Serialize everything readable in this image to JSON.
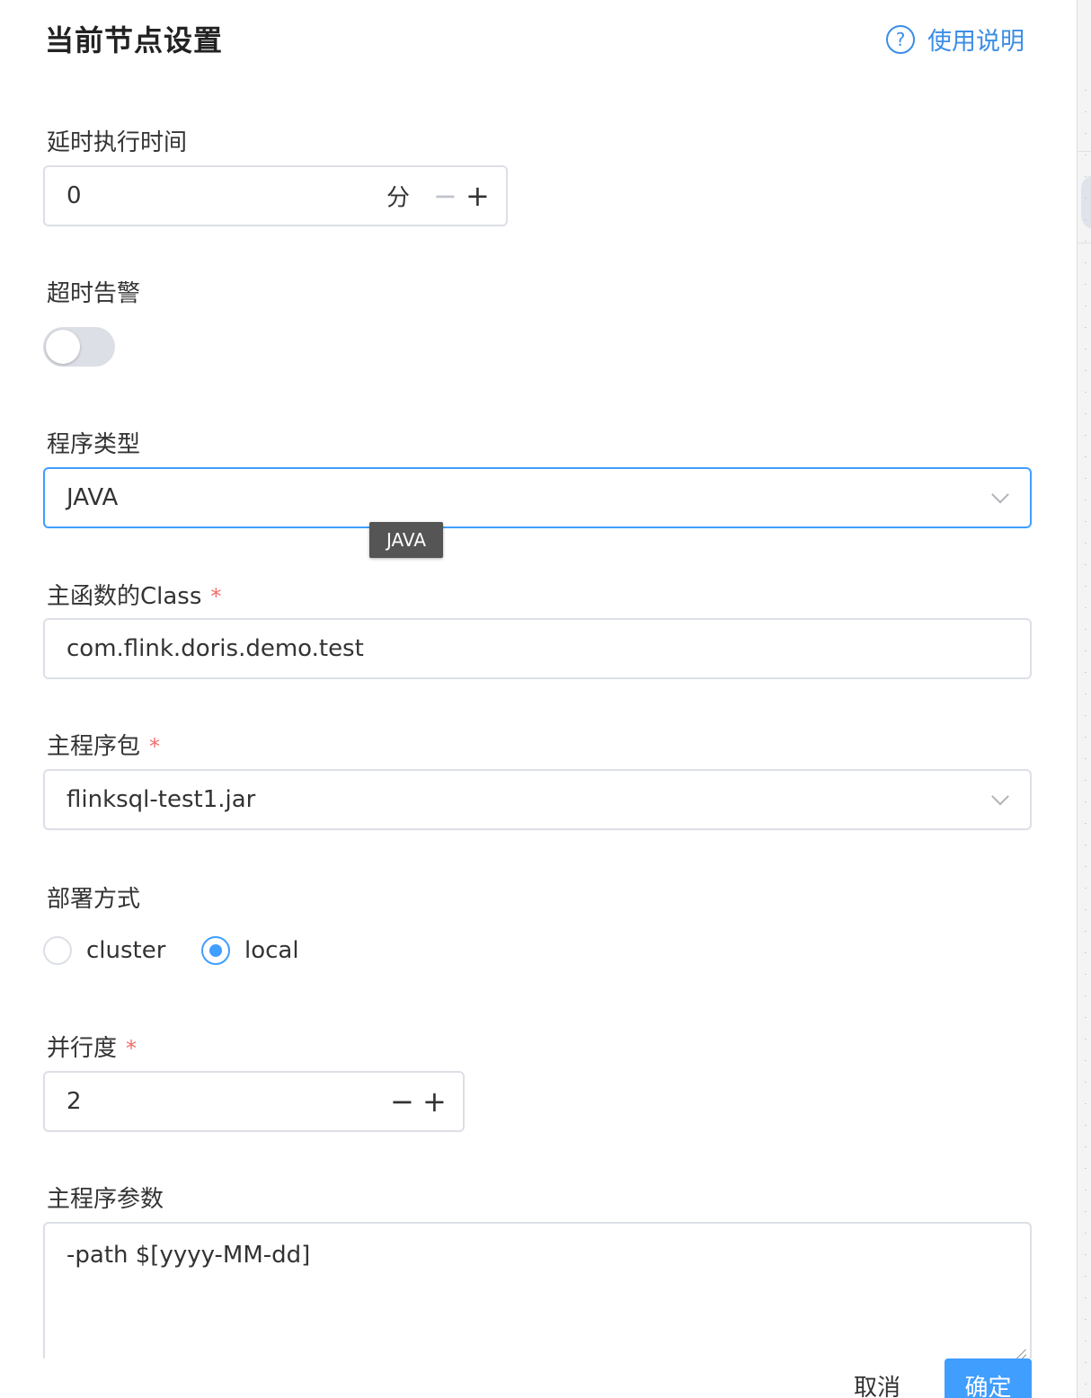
{
  "header": {
    "title": "当前节点设置",
    "help_label": "使用说明",
    "help_icon": "question-circle-icon"
  },
  "delay": {
    "label": "延时执行时间",
    "value": "0",
    "unit": "分",
    "minus": "−",
    "plus": "+"
  },
  "timeout_alarm": {
    "label": "超时告警",
    "enabled": false
  },
  "program_type": {
    "label": "程序类型",
    "value": "JAVA",
    "tooltip": "JAVA"
  },
  "main_class": {
    "label": "主函数的Class",
    "required": "*",
    "value": "com.flink.doris.demo.test"
  },
  "main_package": {
    "label": "主程序包",
    "required": "*",
    "value": "flinksql-test1.jar"
  },
  "deploy_mode": {
    "label": "部署方式",
    "options": [
      "cluster",
      "local"
    ],
    "selected": "local"
  },
  "parallelism": {
    "label": "并行度",
    "required": "*",
    "value": "2",
    "minus": "−",
    "plus": "+"
  },
  "main_args": {
    "label": "主程序参数",
    "value": "-path $[yyyy-MM-dd]"
  },
  "footer": {
    "cancel_label": "取消",
    "ok_label": "确定"
  },
  "colors": {
    "primary": "#409eff",
    "required": "#f56c6c",
    "border": "#dcdfe6"
  }
}
